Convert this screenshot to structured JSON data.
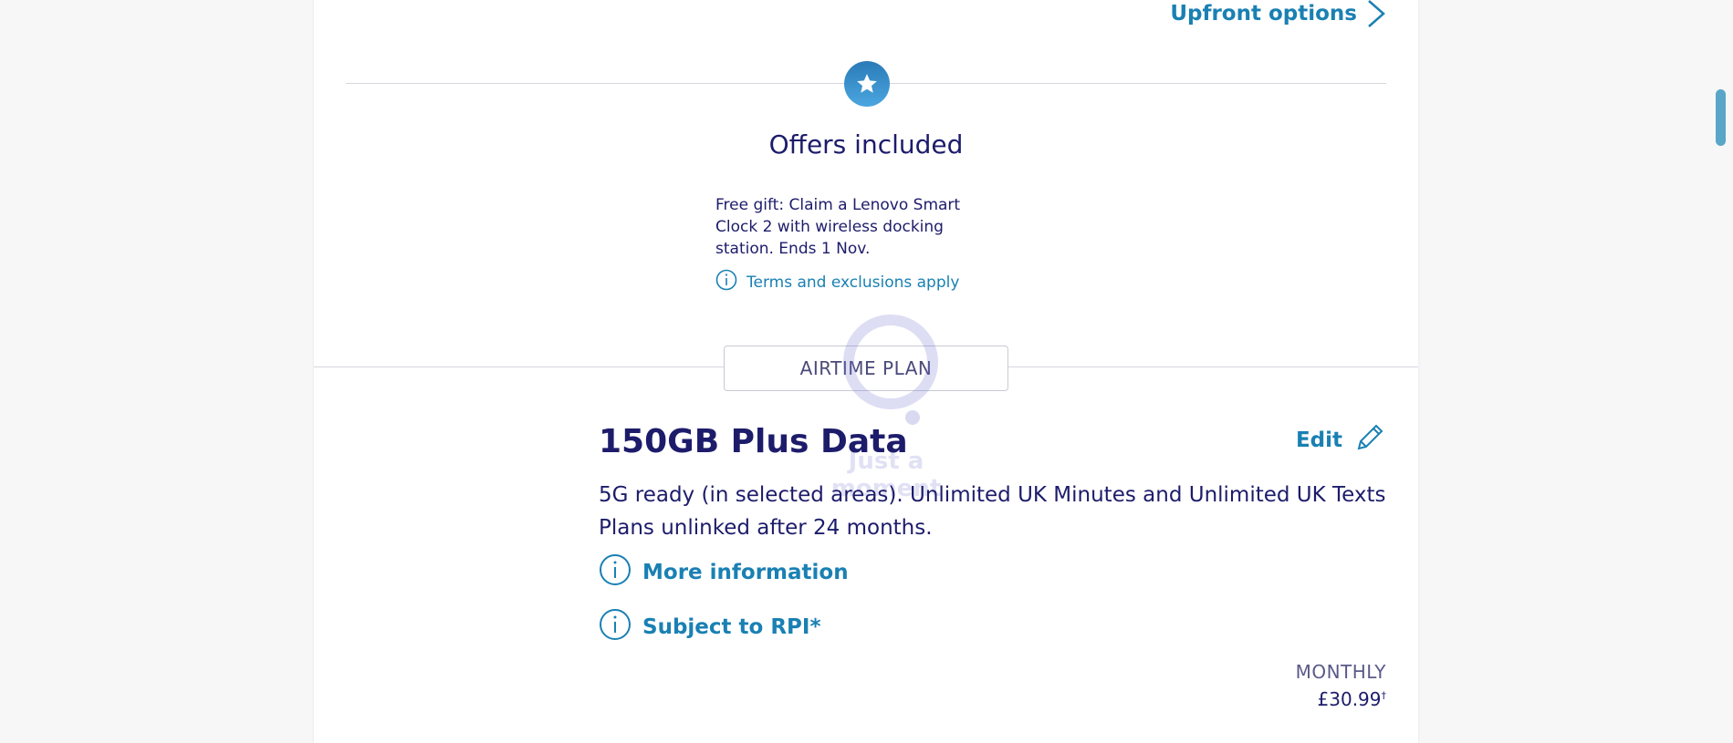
{
  "header": {
    "upfront_label": "Upfront options"
  },
  "offers": {
    "title": "Offers included",
    "text": "Free gift: Claim a Lenovo Smart Clock 2 with wireless docking station. Ends 1 Nov.",
    "terms_label": "Terms and exclusions apply"
  },
  "loader": {
    "message": "Just a moment"
  },
  "plan": {
    "section_label": "AIRTIME PLAN",
    "title": "150GB Plus Data",
    "edit_label": "Edit",
    "description_line1": "5G ready (in selected areas). Unlimited UK Minutes and Unlimited UK Texts",
    "description_line2": "Plans unlinked after 24 months.",
    "more_info_label": "More information",
    "rpi_label": "Subject to RPI*",
    "monthly_label": "MONTHLY",
    "monthly_price": "£30.99",
    "price_marker": "†"
  },
  "colors": {
    "brand_navy": "#1d1c6b",
    "link_blue": "#1a80b3",
    "star_badge": "#2a7bb7"
  },
  "icons": {
    "upfront": "chevron-right-icon",
    "offers": "star-icon",
    "info": "info-icon",
    "edit": "pencil-icon"
  }
}
